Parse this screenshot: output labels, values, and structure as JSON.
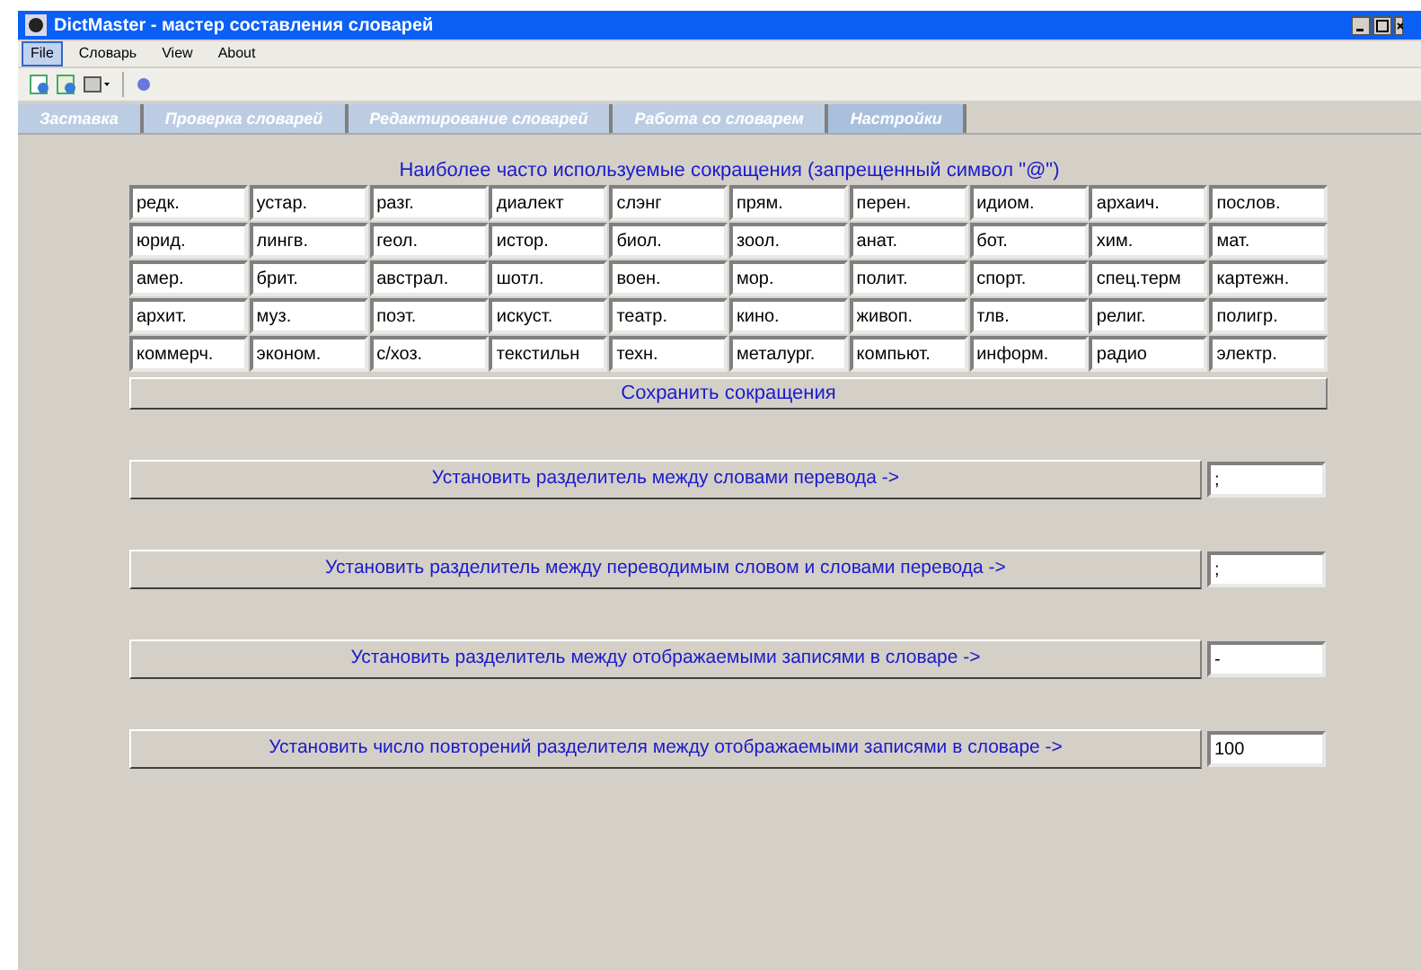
{
  "window": {
    "title": "DictMaster - мастер составления словарей"
  },
  "menu": [
    {
      "label": "File",
      "selected": true
    },
    {
      "label": "Словарь",
      "selected": false
    },
    {
      "label": "View",
      "selected": false
    },
    {
      "label": "About",
      "selected": false
    }
  ],
  "tabs": [
    {
      "label": "Заставка",
      "selected": false
    },
    {
      "label": "Проверка словарей",
      "selected": false
    },
    {
      "label": "Редактирование словарей",
      "selected": false
    },
    {
      "label": "Работа со словарем",
      "selected": false
    },
    {
      "label": "Настройки",
      "selected": true
    }
  ],
  "abbreviations": {
    "caption": "Наиболее часто используемые сокращения (запрещенный символ \"@\")",
    "rows": [
      [
        "редк.",
        "устар.",
        "разг.",
        "диалект",
        "слэнг",
        "прям.",
        "перен.",
        "идиом.",
        "архаич.",
        "послов."
      ],
      [
        "юрид.",
        "лингв.",
        "геол.",
        "истор.",
        "биол.",
        "зоол.",
        "анат.",
        "бот.",
        "хим.",
        "мат."
      ],
      [
        "амер.",
        "брит.",
        "австрал.",
        "шотл.",
        "воен.",
        "мор.",
        "полит.",
        "спорт.",
        "спец.терм",
        "картежн."
      ],
      [
        "архит.",
        "муз.",
        "поэт.",
        "искуст.",
        "театр.",
        "кино.",
        "живоп.",
        "тлв.",
        "религ.",
        "полигр."
      ],
      [
        "коммерч.",
        "эконом.",
        "с/хоз.",
        "текстильн",
        "техн.",
        "металург.",
        "компьют.",
        "информ.",
        "радио",
        "электр."
      ]
    ],
    "save_button": "Сохранить сокращения"
  },
  "settings": [
    {
      "button": "Установить разделитель между словами перевода  ->",
      "value": ";"
    },
    {
      "button": "Установить разделитель между переводимым словом и словами перевода  ->",
      "value": ";"
    },
    {
      "button": "Установить разделитель между отображаемыми записями в словаре  ->",
      "value": "-"
    },
    {
      "button": "Установить число повторений разделителя между отображаемыми записями в словаре  ->",
      "value": "100"
    }
  ]
}
